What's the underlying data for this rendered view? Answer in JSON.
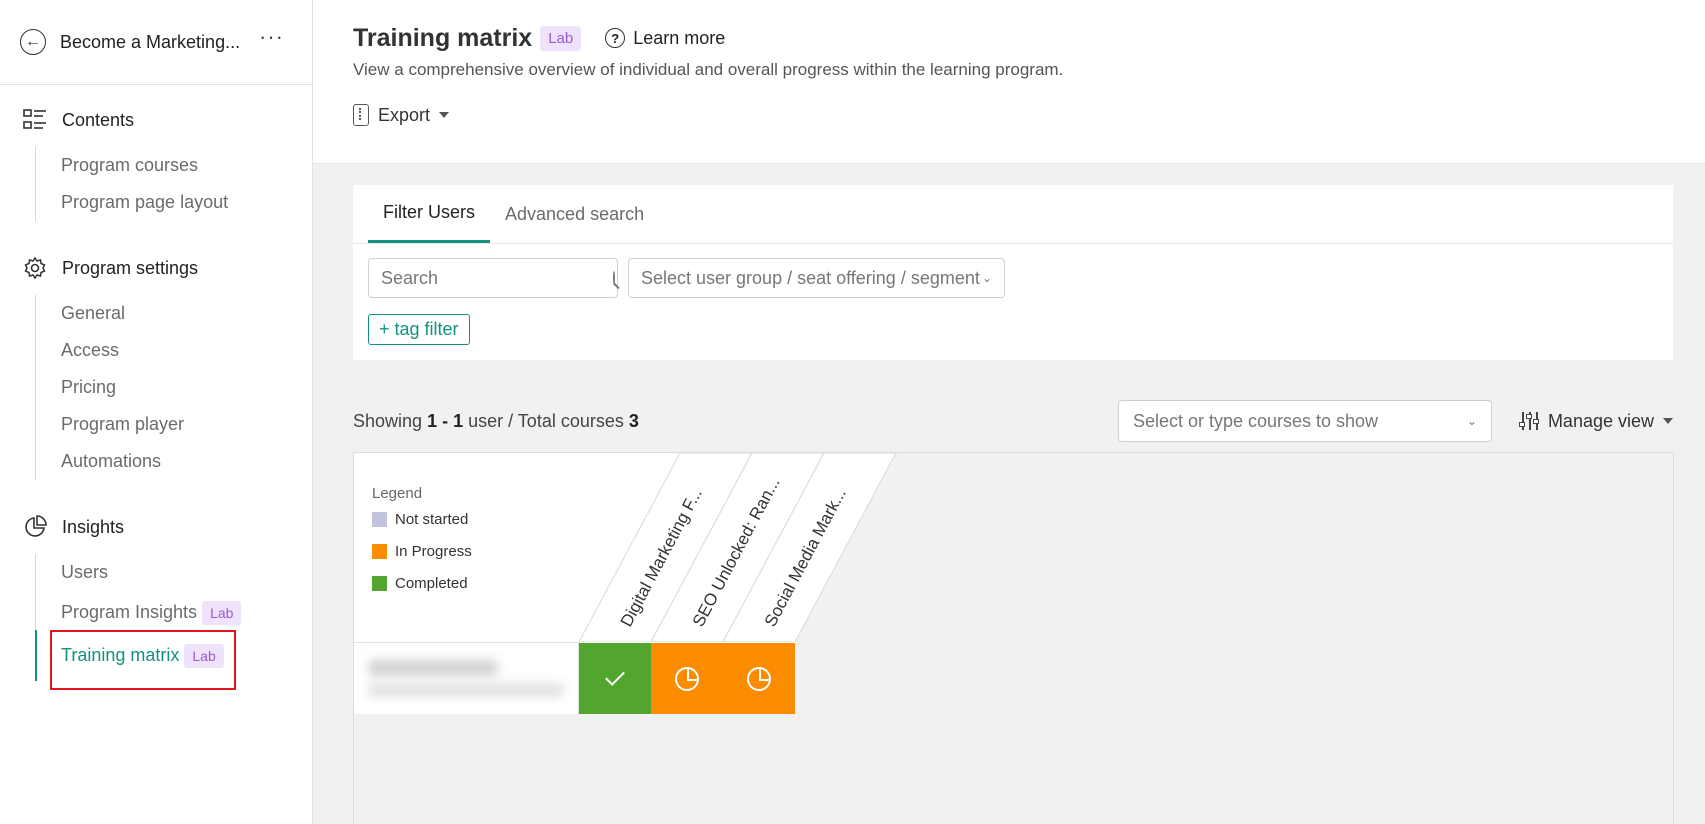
{
  "sidebar": {
    "program_title": "Become a Marketing...",
    "more_label": "···",
    "sections": {
      "contents": {
        "label": "Contents",
        "items": [
          "Program courses",
          "Program page layout"
        ]
      },
      "settings": {
        "label": "Program settings",
        "items": [
          "General",
          "Access",
          "Pricing",
          "Program player",
          "Automations"
        ]
      },
      "insights": {
        "label": "Insights",
        "items": [
          "Users",
          "Program Insights",
          "Training matrix"
        ]
      }
    },
    "lab_badge": "Lab"
  },
  "header": {
    "title": "Training matrix",
    "badge": "Lab",
    "learn_more": "Learn more",
    "subtitle": "View a comprehensive overview of individual and overall progress within the learning program.",
    "export_label": "Export"
  },
  "filters": {
    "tabs": [
      "Filter Users",
      "Advanced search"
    ],
    "search_placeholder": "Search",
    "group_select": "Select user group / seat offering / segment",
    "tag_filter": "+ tag filter"
  },
  "summary": {
    "showing_prefix": "Showing",
    "range": "1 - 1",
    "users_label": "user / Total courses",
    "total_courses": "3",
    "course_select": "Select or type courses to show",
    "manage_view": "Manage view"
  },
  "matrix": {
    "legend_title": "Legend",
    "legend": [
      {
        "label": "Not started",
        "color": "#c0c4dc"
      },
      {
        "label": "In Progress",
        "color": "#fb8c00"
      },
      {
        "label": "Completed",
        "color": "#52a62d"
      }
    ],
    "courses": [
      "Digital Marketing F...",
      "SEO Unlocked: Ran...",
      "Social Media Mark..."
    ],
    "status": [
      "completed",
      "in-progress",
      "in-progress"
    ]
  },
  "colors": {
    "accent": "#12927e",
    "completed": "#52a62d",
    "in_progress": "#fb8c00",
    "lab": "#9b59d0"
  }
}
